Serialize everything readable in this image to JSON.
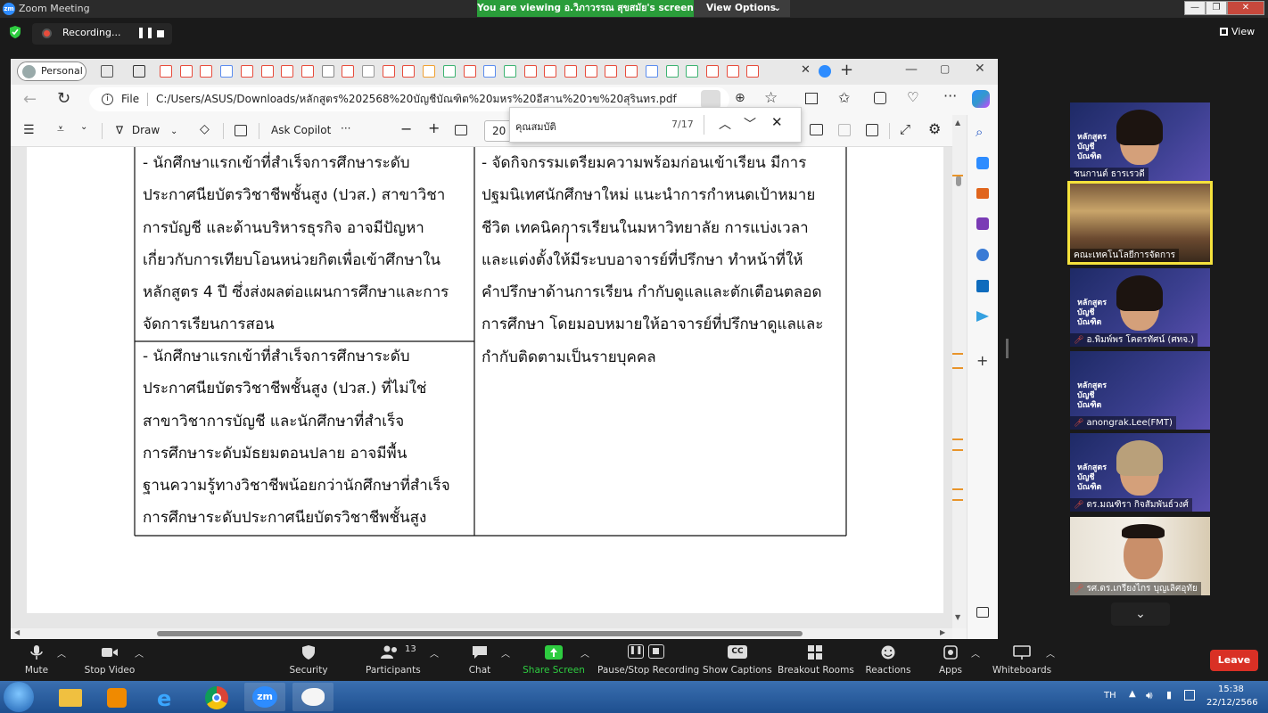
{
  "zoom": {
    "window_title": "Zoom Meeting",
    "logo_text": "zm",
    "share_banner": "You are viewing อ.วิภาวรรณ สุขสมัย's screen",
    "view_options": "View Options",
    "recording_label": "Recording...",
    "view_button": "View"
  },
  "browser": {
    "profile_label": "Personal",
    "file_label": "File",
    "url": "C:/Users/ASUS/Downloads/หลักสูตร%202568%20บัญชีบัณฑิต%20มหร%20อีสาน%20วข%20สุรินทร.pdf",
    "toolbar": {
      "draw": "Draw",
      "ask_copilot": "Ask Copilot",
      "more": "···",
      "zoom_value": "20"
    },
    "find": {
      "query": "คุณสมบัติ",
      "count": "7/17"
    }
  },
  "pdf": {
    "left_col_row1": [
      "- นักศึกษาแรกเข้าที่สำเร็จการศึกษาระดับ",
      "ประกาศนียบัตรวิชาชีพชั้นสูง (ปวส.) สาขาวิชา",
      "การบัญชี และด้านบริหารธุรกิจ อาจมีปัญหา",
      "เกี่ยวกับการเทียบโอนหน่วยกิตเพื่อเข้าศึกษาใน",
      "หลักสูตร 4 ปี ซึ่งส่งผลต่อแผนการศึกษาและการ",
      "จัดการเรียนการสอน"
    ],
    "left_col_row2": [
      "- นักศึกษาแรกเข้าที่สำเร็จการศึกษาระดับ",
      "ประกาศนียบัตรวิชาชีพชั้นสูง (ปวส.) ที่ไม่ใช่",
      "สาขาวิชาการบัญชี และนักศึกษาที่สำเร็จ",
      "การศึกษาระดับมัธยมตอนปลาย อาจมีพื้น",
      "ฐานความรู้ทางวิชาชีพน้อยกว่านักศึกษาที่สำเร็จ",
      "การศึกษาระดับประกาศนียบัตรวิชาชีพชั้นสูง"
    ],
    "right_col": [
      "- จัดกิจกรรมเตรียมความพร้อมก่อนเข้าเรียน มีการ",
      "ปฐมนิเทศนักศึกษาใหม่ แนะนำการกำหนดเป้าหมาย",
      "ชีวิต เทคนิคการเรียนในมหาวิทยาลัย การแบ่งเวลา",
      "และแต่งตั้งให้มีระบบอาจารย์ที่ปรึกษา ทำหน้าที่ให้",
      "คำปรึกษาด้านการเรียน กำกับดูแลและตักเตือนตลอด",
      "การศึกษา โดยมอบหมายให้อาจารย์ที่ปรึกษาดูแลและ",
      "กำกับติดตามเป็นรายบุคคล"
    ]
  },
  "participants_video": [
    {
      "name": "ชนกานต์ ธารเรวดี",
      "banner": "หลักสูตร บัญชีบัณฑิต"
    },
    {
      "name": "คณะเทคโนโลยีการจัดการ",
      "banner": ""
    },
    {
      "name": "อ.พิมพ์พร โคตรทัศน์ (ศทจ.)",
      "banner": "หลักสูตร บัญชีบัณฑิต"
    },
    {
      "name": "anongrak.Lee(FMT)",
      "banner": "หลักสูตร บัญชีบัณฑิต"
    },
    {
      "name": "ดร.มณฑิรา กิจสัมพันธ์วงศ์",
      "banner": "หลักสูตร บัญชีบัณฑิต"
    },
    {
      "name": "รศ.ดร.เกรียงไกร บุญเลิศอุทัย",
      "banner": ""
    }
  ],
  "zoom_toolbar": {
    "mute": "Mute",
    "stop_video": "Stop Video",
    "security": "Security",
    "participants": "Participants",
    "participants_count": "13",
    "chat": "Chat",
    "share_screen": "Share Screen",
    "pause_recording": "Pause/Stop Recording",
    "captions": "Show Captions",
    "breakout": "Breakout Rooms",
    "reactions": "Reactions",
    "apps": "Apps",
    "whiteboards": "Whiteboards",
    "leave": "Leave",
    "captions_icon": "CC"
  },
  "taskbar": {
    "language": "TH",
    "time": "15:38",
    "date": "22/12/2566",
    "zoom_app_text": "zm"
  },
  "colors": {
    "share_banner_green": "#2a9d3a",
    "leave_red": "#d93025",
    "share_screen_green": "#2ecc40"
  }
}
